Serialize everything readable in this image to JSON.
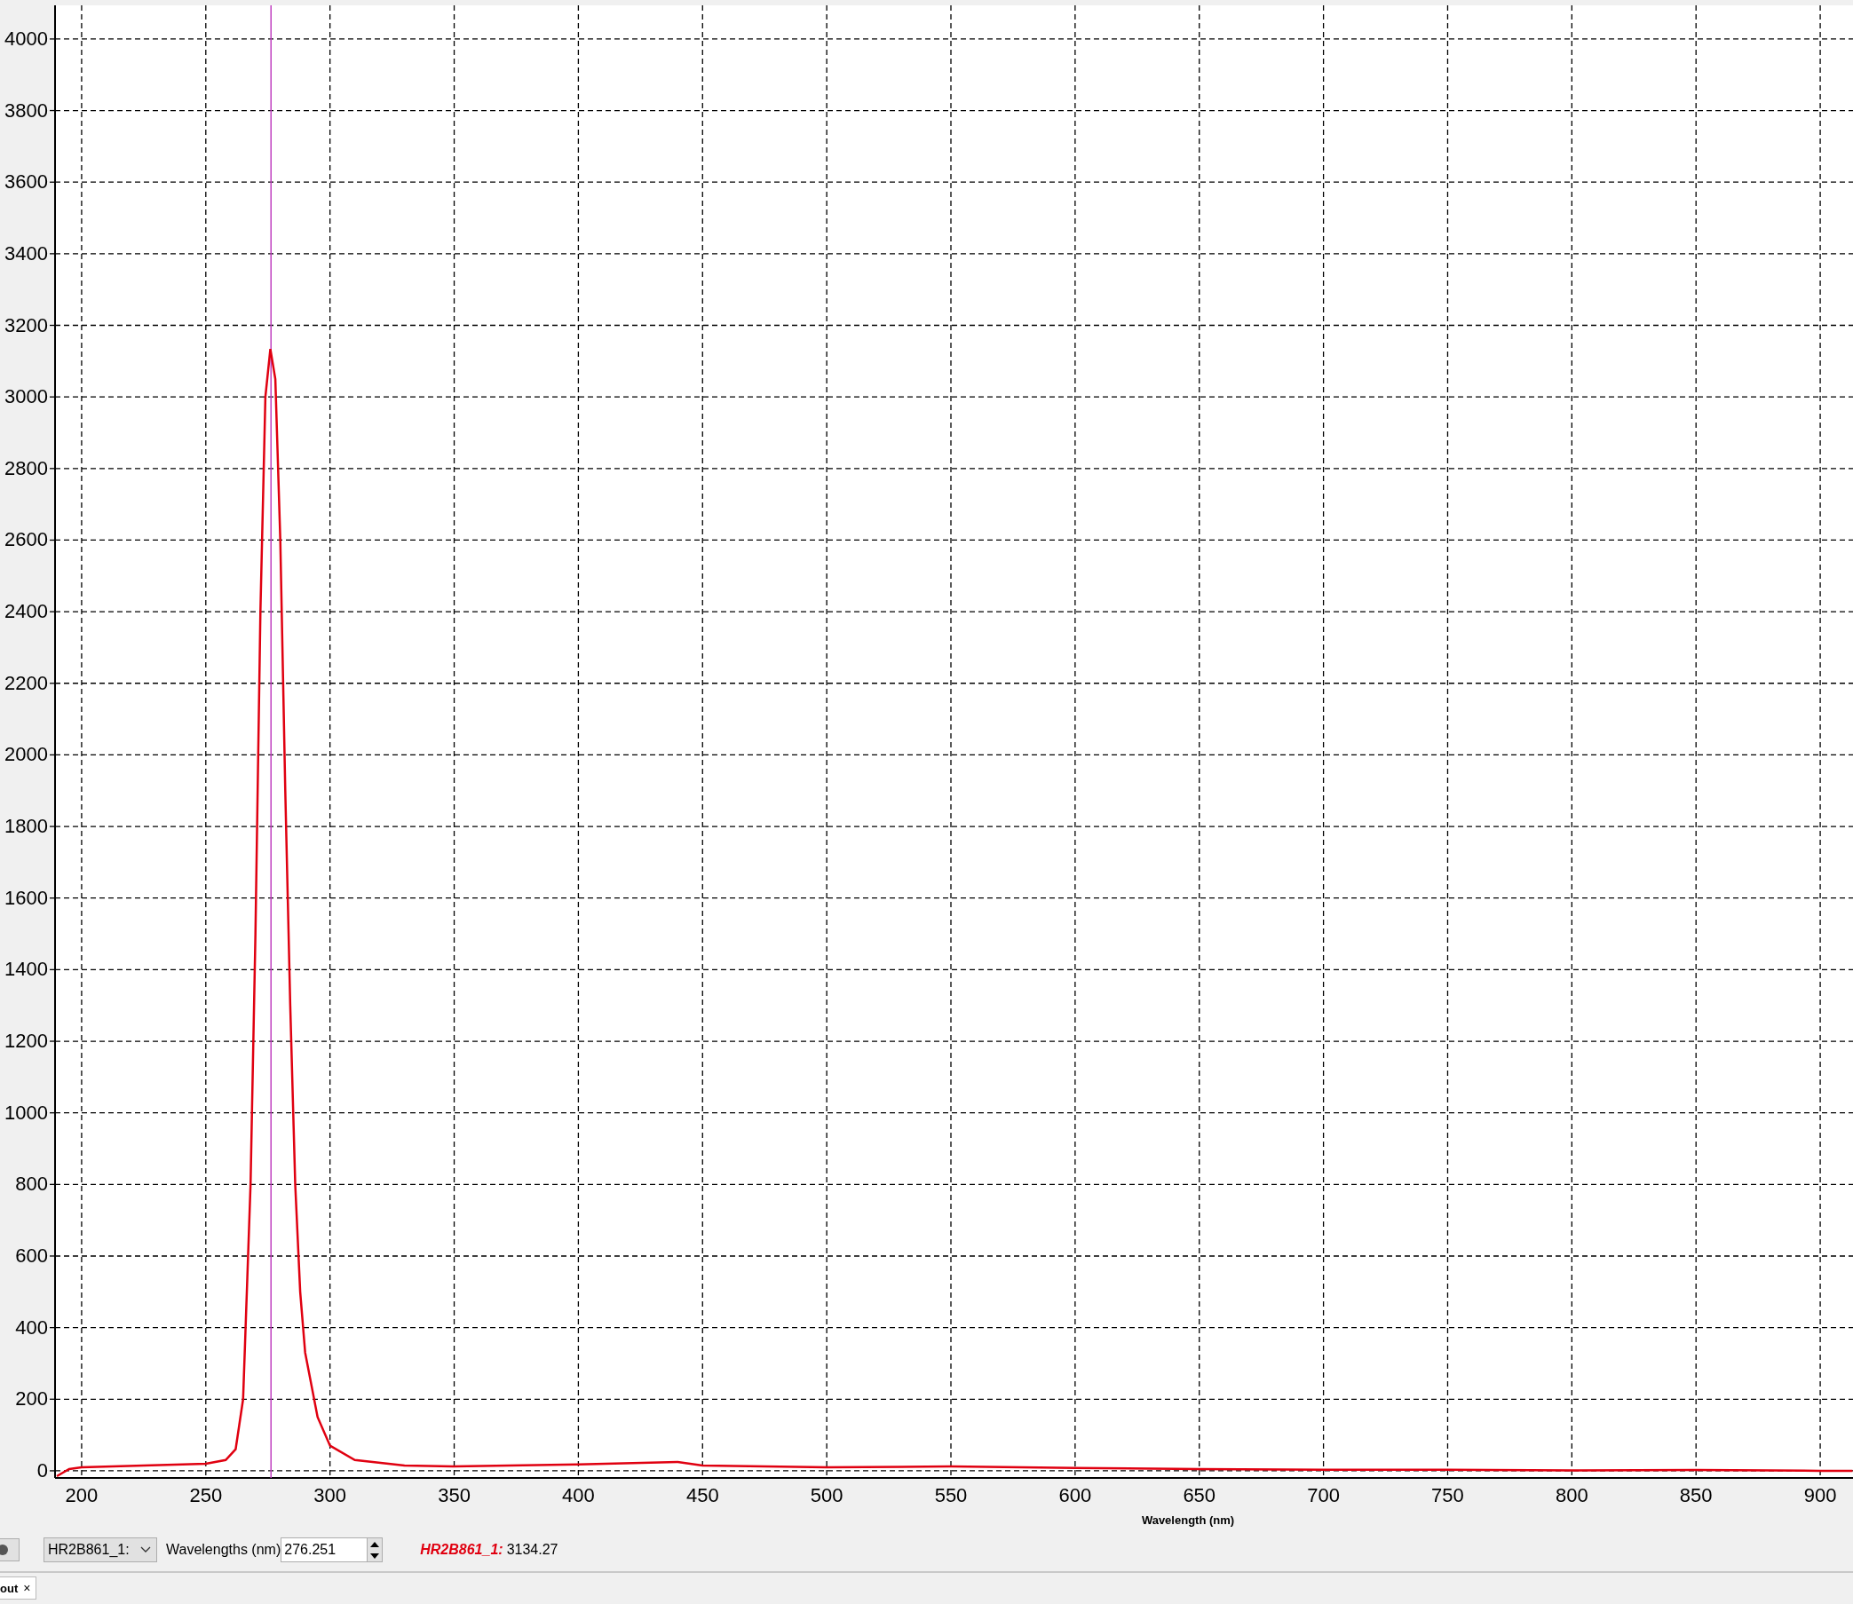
{
  "chart": {
    "chart_data": {
      "type": "line",
      "xlabel": "Wavelength (nm)",
      "x": [
        190,
        195,
        200,
        225,
        250,
        258,
        262,
        265,
        268,
        270,
        272,
        274,
        276,
        278,
        280,
        282,
        284,
        286,
        288,
        290,
        295,
        300,
        310,
        330,
        350,
        400,
        440,
        450,
        500,
        550,
        600,
        650,
        700,
        750,
        800,
        850,
        900,
        913
      ],
      "series": [
        {
          "color": "#e00010",
          "values": [
            -15,
            5,
            10,
            15,
            20,
            30,
            60,
            200,
            800,
            1500,
            2400,
            3000,
            3134,
            3050,
            2600,
            1900,
            1300,
            800,
            500,
            330,
            150,
            70,
            30,
            15,
            12,
            18,
            25,
            15,
            10,
            12,
            8,
            5,
            3,
            3,
            1,
            2,
            0,
            0
          ]
        }
      ],
      "xlim": [
        189.3,
        913.2
      ],
      "ylim": [
        -20,
        4094
      ],
      "xticks": [
        200,
        250,
        300,
        350,
        400,
        450,
        500,
        550,
        600,
        650,
        700,
        750,
        800,
        850,
        900
      ],
      "yticks": [
        0,
        200,
        400,
        600,
        800,
        1000,
        1200,
        1400,
        1600,
        1800,
        2000,
        2200,
        2400,
        2600,
        2800,
        3000,
        3200,
        3400,
        3600,
        3800,
        4000
      ],
      "grid": true,
      "ref_lines": [
        {
          "axis": "x",
          "value": 276.251,
          "color": "#c040c0"
        }
      ]
    }
  },
  "toolbar": {
    "series_select": "HR2B861_1:",
    "wavelength_label": "Wavelengths (nm)",
    "wavelength_value": "276.251",
    "readout_label": "HR2B861_1:",
    "readout_value": "3134.27"
  },
  "tabs": [
    {
      "label": "out",
      "close": "×",
      "selected": true
    }
  ]
}
